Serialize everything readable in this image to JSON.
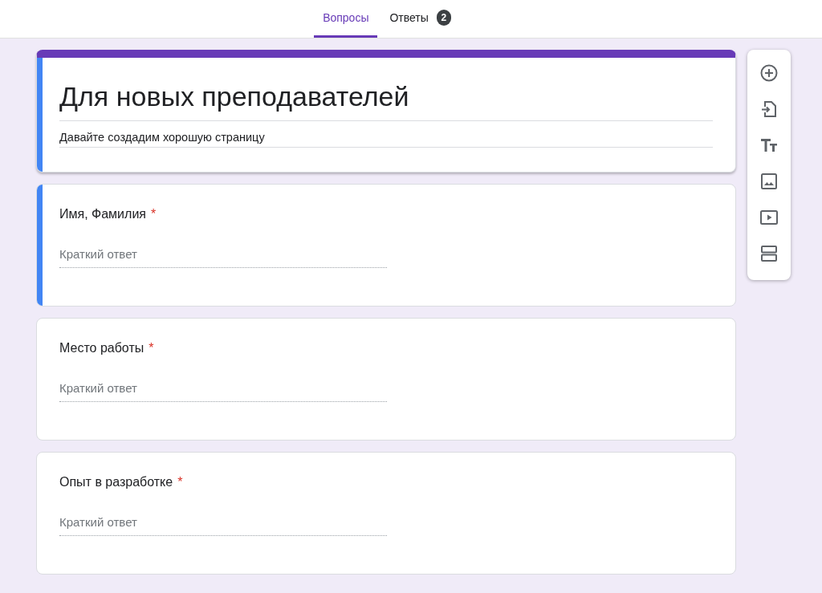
{
  "tabs": [
    {
      "label": "Вопросы",
      "selected": true
    },
    {
      "label": "Ответы",
      "selected": false,
      "badge": "2"
    }
  ],
  "form": {
    "title": "Для новых преподавателей",
    "description": "Давайте создадим хорошую страницу",
    "highlighted": true
  },
  "questions": [
    {
      "title": "Имя, Фамилия",
      "mark": "*",
      "placeholder": "Краткий ответ",
      "highlighted": true
    },
    {
      "title": "Место работы",
      "mark": "*",
      "placeholder": "Краткий ответ",
      "highlighted": false
    },
    {
      "title": "Опыт в разработке",
      "mark": "*",
      "placeholder": "Краткий ответ",
      "highlighted": false
    }
  ],
  "tools": [
    {
      "kind": "add"
    },
    {
      "kind": "import"
    },
    {
      "kind": "text"
    },
    {
      "kind": "image"
    },
    {
      "kind": "video"
    },
    {
      "kind": "section"
    }
  ]
}
